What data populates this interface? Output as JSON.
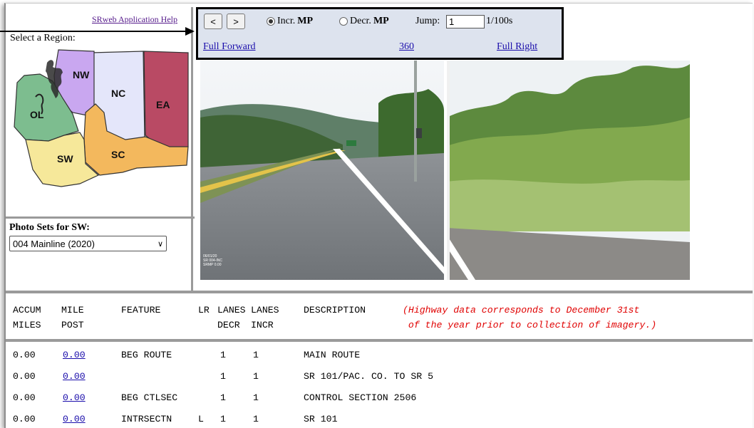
{
  "help_link": "SRweb Application Help",
  "region_label": "Select a Region:",
  "regions": [
    {
      "code": "NW",
      "color": "#c9a7f0"
    },
    {
      "code": "NC",
      "color": "#e4e6fa"
    },
    {
      "code": "EA",
      "color": "#b94a64"
    },
    {
      "code": "OL",
      "color": "#7dbd8f"
    },
    {
      "code": "SW",
      "color": "#f6e89a"
    },
    {
      "code": "SC",
      "color": "#f3b85d"
    }
  ],
  "photo_sets_label": "Photo Sets for SW:",
  "photo_set_selected": "004 Mainline (2020)",
  "controls": {
    "prev": "<",
    "next": ">",
    "incr_label": "Incr.",
    "incr_mp": "MP",
    "decr_label": "Decr.",
    "decr_mp": "MP",
    "jump_label": "Jump:",
    "jump_value": "1",
    "jump_unit": "1/100s",
    "full_forward": "Full Forward",
    "view_360": "360",
    "full_right": "Full Right"
  },
  "photo_stamp": [
    "06/01/20",
    "SR 004-INC",
    "SRMP 0.00"
  ],
  "columns": [
    {
      "line1": "ACCUM",
      "line2": "MILES"
    },
    {
      "line1": "MILE",
      "line2": "POST"
    },
    {
      "line1": "FEATURE",
      "line2": ""
    },
    {
      "line1": "LR",
      "line2": ""
    },
    {
      "line1": "LANES",
      "line2": "DECR"
    },
    {
      "line1": "LANES",
      "line2": "INCR"
    },
    {
      "line1": "DESCRIPTION",
      "line2": ""
    }
  ],
  "note": {
    "line1": "(Highway data corresponds to December 31st",
    "line2": " of the year prior to collection of imagery.)"
  },
  "rows": [
    {
      "accum": "0.00",
      "milepost": "0.00",
      "feature": "BEG ROUTE",
      "lr": "",
      "decr": "1",
      "incr": "1",
      "desc": "MAIN ROUTE"
    },
    {
      "accum": "0.00",
      "milepost": "0.00",
      "feature": "",
      "lr": "",
      "decr": "1",
      "incr": "1",
      "desc": "SR 101/PAC. CO. TO SR 5"
    },
    {
      "accum": "0.00",
      "milepost": "0.00",
      "feature": "BEG CTLSEC",
      "lr": "",
      "decr": "1",
      "incr": "1",
      "desc": "CONTROL SECTION 2506"
    },
    {
      "accum": "0.00",
      "milepost": "0.00",
      "feature": "INTRSECTN",
      "lr": "L",
      "decr": "1",
      "incr": "1",
      "desc": "SR 101"
    }
  ]
}
